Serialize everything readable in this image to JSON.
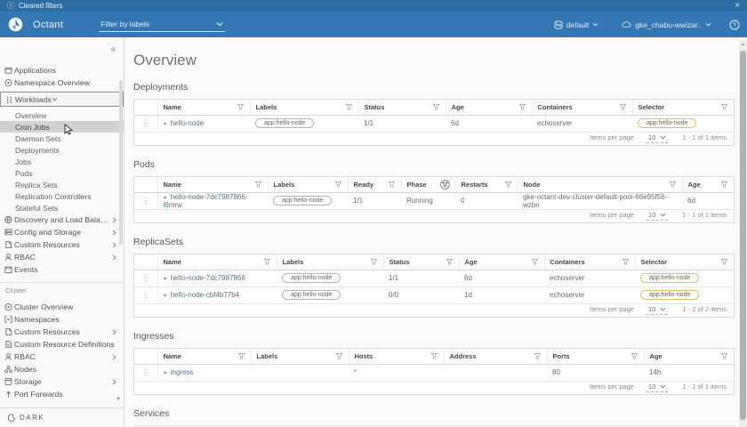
{
  "notification": {
    "message": "Cleared filters",
    "close_label": "×"
  },
  "header": {
    "product": "Octant",
    "filter_placeholder": "Filter by labels",
    "namespace": "default",
    "context": "gke_chabu-wwizar..",
    "help_label": "?"
  },
  "sidebar": {
    "collapse_icon": "«",
    "groups": [
      {
        "items": [
          {
            "icon": "applications-icon",
            "label": "Applications"
          },
          {
            "icon": "namespace-overview-icon",
            "label": "Namespace Overview"
          },
          {
            "icon": "workloads-icon",
            "label": "Workloads",
            "expanded": true,
            "children": [
              {
                "label": "Overview"
              },
              {
                "label": "Cron Jobs",
                "selected": true
              },
              {
                "label": "Daemon Sets"
              },
              {
                "label": "Deployments"
              },
              {
                "label": "Jobs"
              },
              {
                "label": "Pods"
              },
              {
                "label": "Replica Sets"
              },
              {
                "label": "Replication Controllers"
              },
              {
                "label": "Stateful Sets"
              }
            ]
          },
          {
            "icon": "discovery-icon",
            "label": "Discovery and Load Balanc...",
            "chevron": true
          },
          {
            "icon": "config-storage-icon",
            "label": "Config and Storage",
            "chevron": true
          },
          {
            "icon": "custom-resources-icon",
            "label": "Custom Resources",
            "chevron": true
          },
          {
            "icon": "rbac-icon",
            "label": "RBAC",
            "chevron": true
          },
          {
            "icon": "events-icon",
            "label": "Events"
          }
        ]
      },
      {
        "label": "Cluster",
        "items": [
          {
            "icon": "cluster-overview-icon",
            "label": "Cluster Overview"
          },
          {
            "icon": "namespaces-icon",
            "label": "Namespaces"
          },
          {
            "icon": "custom-resources-icon",
            "label": "Custom Resources",
            "chevron": true
          },
          {
            "icon": "crd-icon",
            "label": "Custom Resource Definitions"
          },
          {
            "icon": "rbac-icon",
            "label": "RBAC",
            "chevron": true
          },
          {
            "icon": "nodes-icon",
            "label": "Nodes"
          },
          {
            "icon": "storage-icon",
            "label": "Storage",
            "chevron": true
          },
          {
            "icon": "port-forwards-icon",
            "label": "Port Forwards"
          }
        ]
      }
    ],
    "theme_toggle": "DARK"
  },
  "main": {
    "title": "Overview",
    "pagination_label": "Items per page",
    "sections": [
      {
        "title": "Deployments",
        "columns": [
          {
            "label": "Name"
          },
          {
            "label": "Labels"
          },
          {
            "label": "Status"
          },
          {
            "label": "Age"
          },
          {
            "label": "Containers"
          },
          {
            "label": "Selector"
          }
        ],
        "rows": [
          {
            "cells": [
              {
                "type": "name",
                "text": "hello-node"
              },
              {
                "type": "chip",
                "text": "app:hello-node"
              },
              {
                "type": "text",
                "text": "1/1"
              },
              {
                "type": "text",
                "text": "6d"
              },
              {
                "type": "text",
                "text": "echoserver"
              },
              {
                "type": "selector",
                "text": "app:hello-node"
              }
            ]
          }
        ],
        "pagination": {
          "page_size": "10",
          "range": "1 - 1 of 1 items"
        }
      },
      {
        "title": "Pods",
        "columns": [
          {
            "label": "Name"
          },
          {
            "label": "Labels"
          },
          {
            "label": "Ready"
          },
          {
            "label": "Phase",
            "filter_active": true
          },
          {
            "label": "Restarts"
          },
          {
            "label": "Node"
          },
          {
            "label": "Age"
          }
        ],
        "rows": [
          {
            "cells": [
              {
                "type": "name",
                "text": "hello-node-7dc7987866-l6mrw"
              },
              {
                "type": "chip",
                "text": "app:hello-node"
              },
              {
                "type": "text",
                "text": "1/1"
              },
              {
                "type": "text",
                "text": "Running"
              },
              {
                "type": "text",
                "text": "0"
              },
              {
                "type": "text",
                "text": "gke-octant-dev-cluster-default-pool-66e95f56-wzbn"
              },
              {
                "type": "text",
                "text": "6d"
              }
            ]
          }
        ],
        "pagination": {
          "page_size": "10",
          "range": "1 - 1 of 1 items"
        }
      },
      {
        "title": "ReplicaSets",
        "columns": [
          {
            "label": "Name"
          },
          {
            "label": "Labels"
          },
          {
            "label": "Status"
          },
          {
            "label": "Age"
          },
          {
            "label": "Containers"
          },
          {
            "label": "Selector"
          }
        ],
        "rows": [
          {
            "cells": [
              {
                "type": "name",
                "text": "hello-node-7dc7987866"
              },
              {
                "type": "chip",
                "text": "app:hello-node"
              },
              {
                "type": "text",
                "text": "1/1"
              },
              {
                "type": "text",
                "text": "6d"
              },
              {
                "type": "text",
                "text": "echoserver"
              },
              {
                "type": "selector",
                "text": "app:hello-node"
              }
            ]
          },
          {
            "cells": [
              {
                "type": "name",
                "text": "hello-node-cbf4b77b4"
              },
              {
                "type": "chip",
                "text": "app:hello-node"
              },
              {
                "type": "text",
                "text": "0/0"
              },
              {
                "type": "text",
                "text": "1d"
              },
              {
                "type": "text",
                "text": "echoserver"
              },
              {
                "type": "selector",
                "text": "app:hello-node"
              }
            ]
          }
        ],
        "pagination": {
          "page_size": "10",
          "range": "1 - 2 of 2 items"
        }
      },
      {
        "title": "Ingresses",
        "columns": [
          {
            "label": "Name"
          },
          {
            "label": "Labels"
          },
          {
            "label": "Hosts"
          },
          {
            "label": "Address"
          },
          {
            "label": "Ports"
          },
          {
            "label": "Age"
          }
        ],
        "rows": [
          {
            "cells": [
              {
                "type": "name",
                "text": "ingress"
              },
              {
                "type": "text",
                "text": ""
              },
              {
                "type": "text",
                "text": "*"
              },
              {
                "type": "text",
                "text": ""
              },
              {
                "type": "text",
                "text": "80"
              },
              {
                "type": "text",
                "text": "14h"
              }
            ]
          }
        ],
        "pagination": {
          "page_size": "10",
          "range": "1 - 1 of 1 items"
        }
      },
      {
        "title": "Services",
        "columns": [],
        "rows": []
      }
    ]
  }
}
